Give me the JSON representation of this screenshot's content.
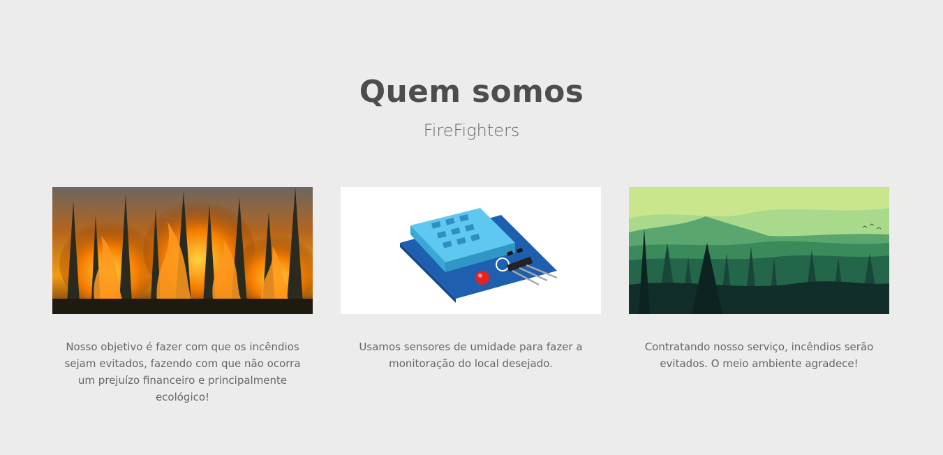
{
  "section": {
    "title": "Quem somos",
    "subtitle": "FireFighters"
  },
  "cards": [
    {
      "image_icon": "forest-fire-image",
      "text": "Nosso objetivo é fazer com que os incêndios sejam evitados, fazendo com que não ocorra um prejuízo financeiro e principalmente ecológico!"
    },
    {
      "image_icon": "humidity-sensor-image",
      "text": "Usamos sensores de umidade para fazer a monitoração do local desejado."
    },
    {
      "image_icon": "green-forest-landscape-image",
      "text": "Contratando nosso serviço, incêndios serão evitados. O meio ambiente agradece!"
    }
  ],
  "colors": {
    "background": "#ececec",
    "title": "#4d4d4d",
    "text": "#666666"
  }
}
